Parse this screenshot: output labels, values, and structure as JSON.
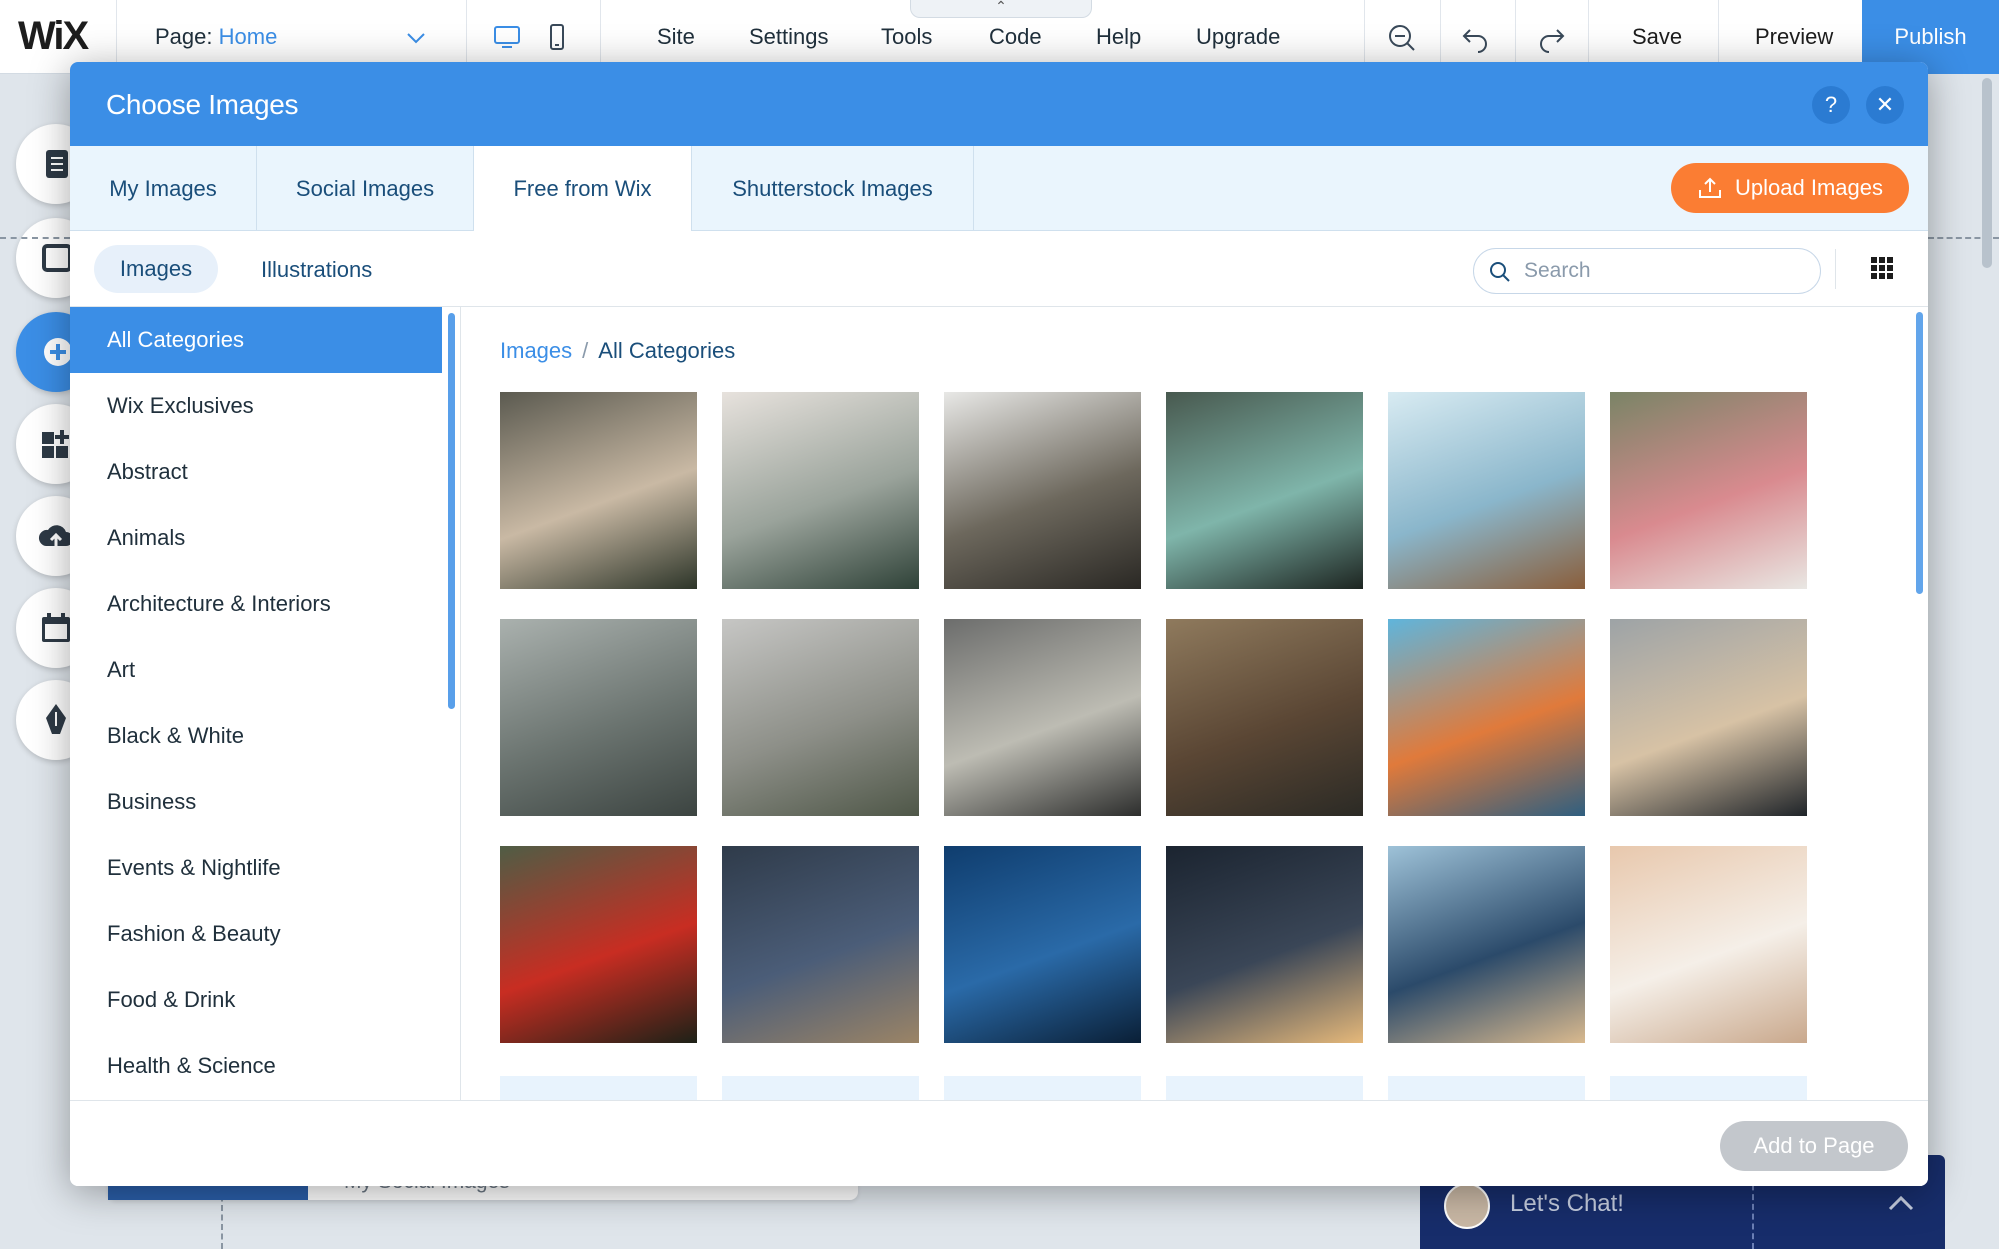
{
  "topbar": {
    "logo": "WiX",
    "page_label": "Page:",
    "page_value": "Home",
    "menu": [
      "Site",
      "Settings",
      "Tools",
      "Code",
      "Help",
      "Upgrade"
    ],
    "save": "Save",
    "preview": "Preview",
    "publish": "Publish",
    "tab_handle": "⌃"
  },
  "modal": {
    "title": "Choose Images",
    "help": "?",
    "close": "✕",
    "tabs": [
      "My Images",
      "Social Images",
      "Free from Wix",
      "Shutterstock Images"
    ],
    "active_tab": "Free from Wix",
    "upload": "Upload Images",
    "subtabs": [
      "Images",
      "Illustrations"
    ],
    "search": {
      "placeholder": "Search",
      "value": ""
    },
    "categories": [
      "All Categories",
      "Wix Exclusives",
      "Abstract",
      "Animals",
      "Architecture & Interiors",
      "Art",
      "Black & White",
      "Business",
      "Events & Nightlife",
      "Fashion & Beauty",
      "Food & Drink",
      "Health & Science"
    ],
    "active_category": "All Categories",
    "breadcrumb": {
      "root": "Images",
      "sep": "/",
      "current": "All Categories"
    },
    "add_to_page": "Add to Page"
  },
  "thumbnails": [
    {
      "subject": "plants-on-porch",
      "colors": [
        "#5b5a50",
        "#c9b9a4",
        "#2d3529"
      ]
    },
    {
      "subject": "misty-forest",
      "colors": [
        "#e7e2dd",
        "#9aa39b",
        "#2f4238"
      ]
    },
    {
      "subject": "window-plant-star",
      "colors": [
        "#e8e8e6",
        "#6d685d",
        "#2a2824"
      ]
    },
    {
      "subject": "mint-scooter",
      "colors": [
        "#48594f",
        "#7fb5aa",
        "#1d2521"
      ]
    },
    {
      "subject": "wooden-reindeer",
      "colors": [
        "#d8ebf2",
        "#8ab6cb",
        "#8a5e3b"
      ]
    },
    {
      "subject": "bridal-bouquet",
      "colors": [
        "#7a8466",
        "#d98a8f",
        "#e9e7e3"
      ]
    },
    {
      "subject": "chairs-aerial",
      "colors": [
        "#aab1ae",
        "#6b7470",
        "#3c4441"
      ]
    },
    {
      "subject": "foggy-cliff",
      "colors": [
        "#c6c6c4",
        "#8d8f88",
        "#4f5748"
      ]
    },
    {
      "subject": "ceramic-bowls",
      "colors": [
        "#6c6d6c",
        "#bdbcb3",
        "#2d2e2d"
      ]
    },
    {
      "subject": "pine-trunks",
      "colors": [
        "#8f7a5d",
        "#5a4634",
        "#2b2a25"
      ]
    },
    {
      "subject": "orange-blossom",
      "colors": [
        "#5fb5dc",
        "#e07a3b",
        "#2f5f80"
      ]
    },
    {
      "subject": "coffee-laptop",
      "colors": [
        "#9da3a6",
        "#d7c2a5",
        "#1f2429"
      ]
    },
    {
      "subject": "red-jacket-hiker",
      "colors": [
        "#4f5d45",
        "#c82d22",
        "#1d2117"
      ]
    },
    {
      "subject": "teapot-top",
      "colors": [
        "#2f3b4a",
        "#4b5d78",
        "#9b8466"
      ]
    },
    {
      "subject": "swimmer-underwater",
      "colors": [
        "#0f3d6e",
        "#2a6aa8",
        "#0a1f36"
      ]
    },
    {
      "subject": "night-lights-tree",
      "colors": [
        "#1b2430",
        "#3a4657",
        "#e5b87a"
      ]
    },
    {
      "subject": "city-skyline",
      "colors": [
        "#9ec2d8",
        "#2b4a6a",
        "#d9b98e"
      ]
    },
    {
      "subject": "lace-dress-back",
      "colors": [
        "#e8c8ad",
        "#f5efe8",
        "#c9a88c"
      ]
    }
  ],
  "background": {
    "panel_label": "My Social Images",
    "chat_label": "Let's Chat!"
  },
  "colors": {
    "accent": "#3b8ee6",
    "upload": "#fb7d33",
    "chat": "#172d6b",
    "disabled": "#c3c7cc"
  }
}
